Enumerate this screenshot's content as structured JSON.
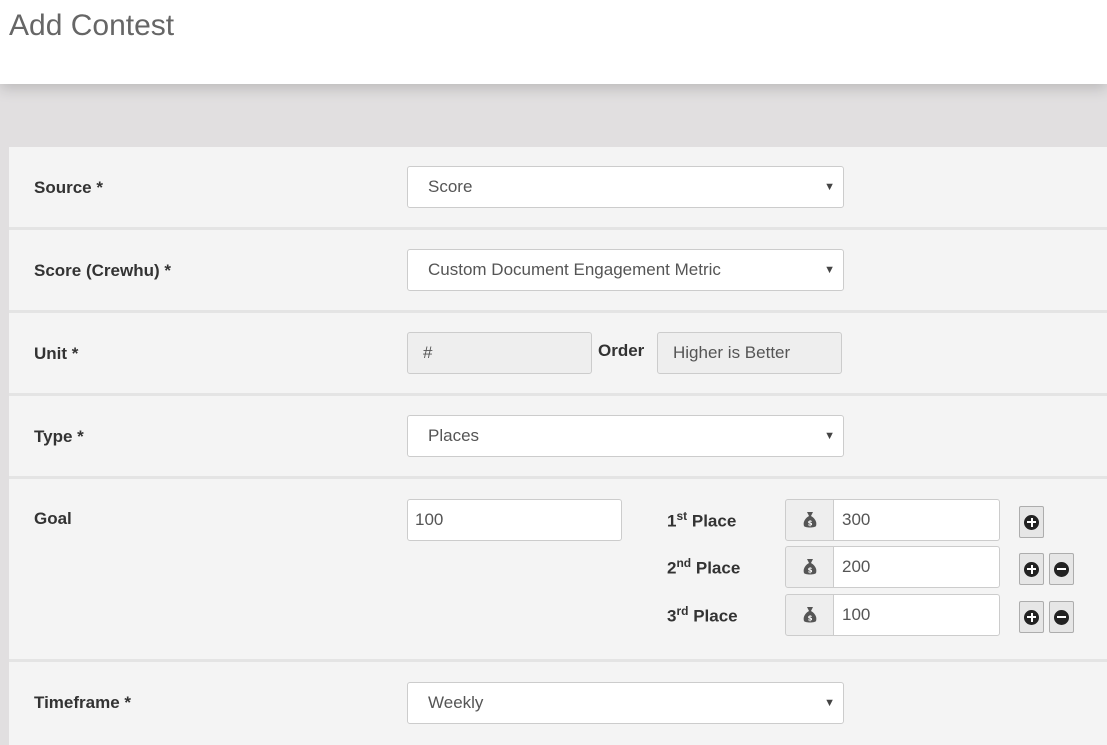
{
  "page": {
    "title": "Add Contest"
  },
  "form": {
    "source": {
      "label": "Source *",
      "value": "Score"
    },
    "score": {
      "label": "Score (Crewhu) *",
      "value": "Custom Document Engagement Metric"
    },
    "unit": {
      "label": "Unit *",
      "value": "#",
      "order_label": "Order",
      "order_value": "Higher is Better"
    },
    "type": {
      "label": "Type *",
      "value": "Places"
    },
    "goal": {
      "label": "Goal",
      "value": "100",
      "places": [
        {
          "num": "1",
          "suffix": "st",
          "word": "Place",
          "prize": "300"
        },
        {
          "num": "2",
          "suffix": "nd",
          "word": "Place",
          "prize": "200"
        },
        {
          "num": "3",
          "suffix": "rd",
          "word": "Place",
          "prize": "100"
        }
      ]
    },
    "timeframe": {
      "label": "Timeframe *",
      "value": "Weekly"
    }
  },
  "icons": {
    "dropdown": "triangle-down",
    "prize": "money-bag-icon",
    "add": "plus-circle-icon",
    "remove": "minus-circle-icon"
  }
}
